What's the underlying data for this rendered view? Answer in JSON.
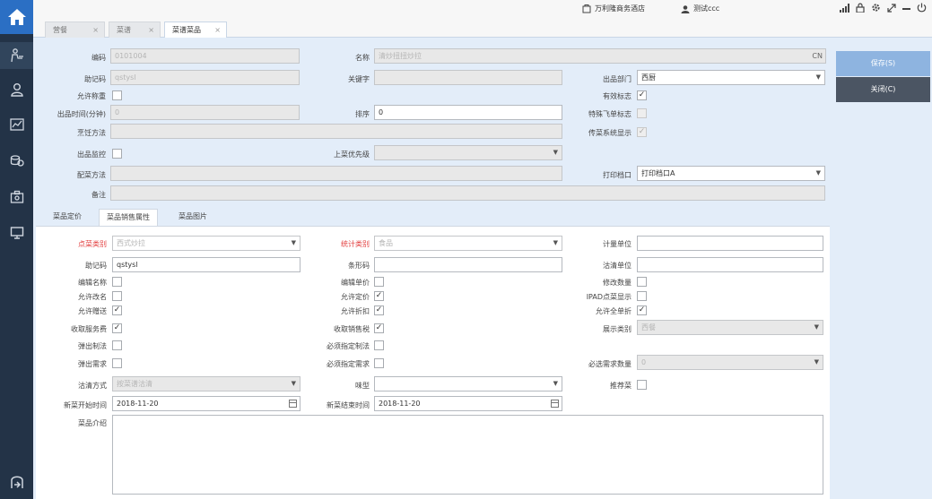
{
  "sidebar": {
    "items": [
      {
        "name": "home-icon"
      },
      {
        "name": "waiter-icon"
      },
      {
        "name": "user-icon"
      },
      {
        "name": "report-icon"
      },
      {
        "name": "coins-icon"
      },
      {
        "name": "portfolio-icon"
      },
      {
        "name": "monitor-icon"
      },
      {
        "name": "logout-icon"
      }
    ]
  },
  "topbar": {
    "hotel": "万利隆商务酒店",
    "user": "测试ccc"
  },
  "tabs": [
    {
      "label": "营餐"
    },
    {
      "label": "菜谱"
    },
    {
      "label": "菜谱菜品"
    }
  ],
  "form": {
    "code_label": "编码",
    "code_value": "0101004",
    "name_label": "名称",
    "name_value": "清炒扭扭炒拉",
    "name_suffix": "CN",
    "mnemonic_label": "助记码",
    "mnemonic_value": "qstysl",
    "keyword_label": "关键字",
    "dept_label": "出品部门",
    "dept_value": "西厨",
    "allow_qty_label": "允许称重",
    "valid_label": "有效标志",
    "time_label": "出品时间(分钟)",
    "time_value": "0",
    "sort_label": "排序",
    "sort_value": "0",
    "flyer_label": "特殊飞单标志",
    "cook_label": "烹饪方法",
    "transfer_label": "传菜系统显示",
    "monitor_label": "出品监控",
    "priority_label": "上菜优先级",
    "garnish_label": "配菜方法",
    "print_label": "打印档口",
    "print_value": "打印档口A",
    "remark_label": "备注"
  },
  "inner_tabs": [
    {
      "label": "菜品定价"
    },
    {
      "label": "菜品销售属性"
    },
    {
      "label": "菜品图片"
    }
  ],
  "sales": {
    "order_cat_label": "点菜类别",
    "order_cat_value": "西式炒拉",
    "stat_cat_label": "统计类别",
    "stat_cat_value": "食品",
    "unit_label": "计量单位",
    "mnemonic_label": "助记码",
    "mnemonic_value": "qstysl",
    "barcode_label": "条形码",
    "clean_unit_label": "沽清单位",
    "edit_name_label": "编辑名称",
    "edit_price_label": "编辑单价",
    "modify_qty_label": "修改数量",
    "rename_label": "允许改名",
    "allow_price_label": "允许定价",
    "ipad_label": "IPAD点菜显示",
    "gift_label": "允许赠送",
    "discount_label": "允许折扣",
    "full_discount_label": "允许全单折",
    "service_fee_label": "收取服务费",
    "sales_tax_label": "收取销售税",
    "display_cat_label": "展示类别",
    "display_cat_value": "西餐",
    "popup_method_label": "弹出制法",
    "must_method_label": "必须指定制法",
    "popup_req_label": "弹出需求",
    "must_req_label": "必须指定需求",
    "req_count_label": "必选需求数量",
    "req_count_value": "0",
    "clean_mode_label": "沽清方式",
    "clean_mode_value": "按菜谱沽清",
    "taste_label": "味型",
    "recommend_label": "推荐菜",
    "new_start_label": "新菜开始时间",
    "new_start_value": "2018-11-20",
    "new_end_label": "新菜结束时间",
    "new_end_value": "2018-11-20",
    "intro_label": "菜品介绍"
  },
  "buttons": {
    "save": "保存(S)",
    "close": "关闭(C)"
  },
  "colors": {
    "sidebar": "#233347",
    "home": "#2b6fc4",
    "form_bg": "#e3edf9",
    "save_btn": "#8eb4e0",
    "close_btn": "#4b5563",
    "required_label": "#e23b3b"
  }
}
